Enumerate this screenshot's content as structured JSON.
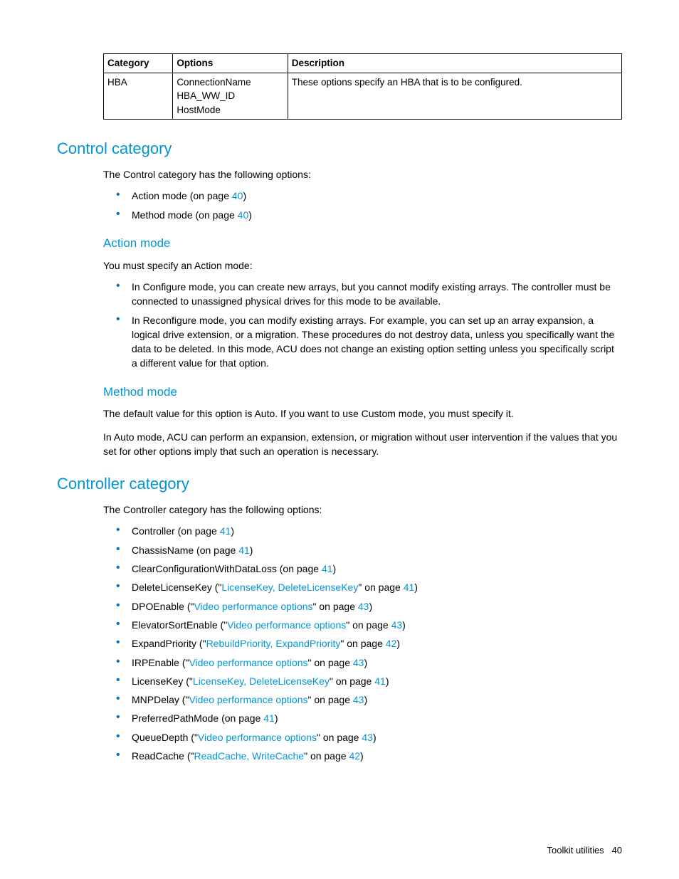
{
  "table": {
    "headers": {
      "cat": "Category",
      "opt": "Options",
      "desc": "Description"
    },
    "row": {
      "cat": "HBA",
      "opts": [
        "ConnectionName",
        "HBA_WW_ID",
        "HostMode"
      ],
      "desc": "These options specify an HBA that is to be configured."
    }
  },
  "control": {
    "title": "Control category",
    "intro": "The Control category has the following options:",
    "opts": [
      {
        "label": "Action mode (on page ",
        "page": "40",
        "suffix": ")"
      },
      {
        "label": "Method mode (on page ",
        "page": "40",
        "suffix": ")"
      }
    ],
    "action": {
      "title": "Action mode",
      "intro": "You must specify an Action mode:",
      "items": [
        "In Configure mode, you can create new arrays, but you cannot modify existing arrays. The controller must be connected to unassigned physical drives for this mode to be available.",
        "In Reconfigure mode, you can modify existing arrays. For example, you can set up an array expansion, a logical drive extension, or a migration. These procedures do not destroy data, unless you specifically want the data to be deleted. In this mode, ACU does not change an existing option setting unless you specifically script a different value for that option."
      ]
    },
    "method": {
      "title": "Method mode",
      "p1": "The default value for this option is Auto. If you want to use Custom mode, you must specify it.",
      "p2": "In Auto mode, ACU can perform an expansion, extension, or migration without user intervention if the values that you set for other options imply that such an operation is necessary."
    }
  },
  "controller": {
    "title": "Controller category",
    "intro": "The Controller category has the following options:",
    "items": [
      {
        "pre": "Controller (on page ",
        "link": "41",
        "post": ")"
      },
      {
        "pre": "ChassisName (on page ",
        "link": "41",
        "post": ")"
      },
      {
        "pre": "ClearConfigurationWithDataLoss (on page ",
        "link": "41",
        "post": ")"
      },
      {
        "pre": "DeleteLicenseKey (\"",
        "link": "LicenseKey, DeleteLicenseKey",
        "mid": "\" on page ",
        "link2": "41",
        "post": ")"
      },
      {
        "pre": "DPOEnable (\"",
        "link": "Video performance options",
        "mid": "\" on page ",
        "link2": "43",
        "post": ")"
      },
      {
        "pre": "ElevatorSortEnable (\"",
        "link": "Video performance options",
        "mid": "\" on page ",
        "link2": "43",
        "post": ")"
      },
      {
        "pre": "ExpandPriority (\"",
        "link": "RebuildPriority, ExpandPriority",
        "mid": "\" on page ",
        "link2": "42",
        "post": ")"
      },
      {
        "pre": "IRPEnable (\"",
        "link": "Video performance options",
        "mid": "\" on page ",
        "link2": "43",
        "post": ")"
      },
      {
        "pre": "LicenseKey (\"",
        "link": "LicenseKey, DeleteLicenseKey",
        "mid": "\" on page ",
        "link2": "41",
        "post": ")"
      },
      {
        "pre": "MNPDelay (\"",
        "link": "Video performance options",
        "mid": "\" on page ",
        "link2": "43",
        "post": ")"
      },
      {
        "pre": "PreferredPathMode (on page ",
        "link": "41",
        "post": ")"
      },
      {
        "pre": "QueueDepth (\"",
        "link": "Video performance options",
        "mid": "\" on page ",
        "link2": "43",
        "post": ")"
      },
      {
        "pre": "ReadCache (\"",
        "link": "ReadCache, WriteCache",
        "mid": "\" on page ",
        "link2": "42",
        "post": ")"
      }
    ]
  },
  "footer": {
    "label": "Toolkit utilities",
    "page": "40"
  }
}
